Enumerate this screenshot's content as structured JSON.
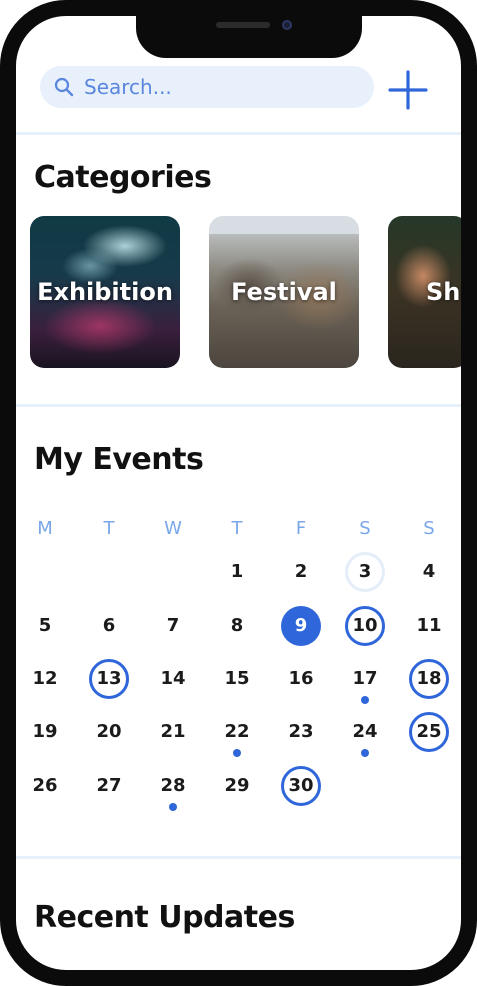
{
  "search": {
    "placeholder": "Search..."
  },
  "sections": {
    "categories_title": "Categories",
    "events_title": "My Events",
    "updates_title": "Recent Updates"
  },
  "categories": [
    {
      "label": "Exhibition"
    },
    {
      "label": "Festival"
    },
    {
      "label": "Sh"
    }
  ],
  "calendar": {
    "weekdays": [
      "M",
      "T",
      "W",
      "T",
      "F",
      "S",
      "S"
    ],
    "days": {
      "d1": "1",
      "d2": "2",
      "d3": "3",
      "d4": "4",
      "d5": "5",
      "d6": "6",
      "d7": "7",
      "d8": "8",
      "d9": "9",
      "d10": "10",
      "d11": "11",
      "d12": "12",
      "d13": "13",
      "d14": "14",
      "d15": "15",
      "d16": "16",
      "d17": "17",
      "d18": "18",
      "d19": "19",
      "d20": "20",
      "d21": "21",
      "d22": "22",
      "d23": "23",
      "d24": "24",
      "d25": "25",
      "d26": "26",
      "d27": "27",
      "d28": "28",
      "d29": "29",
      "d30": "30"
    },
    "selected_day": 9,
    "today_day": 3,
    "event_days_ringed": [
      10,
      13,
      18,
      25,
      30
    ],
    "days_with_dots": [
      17,
      22,
      24,
      28
    ]
  },
  "colors": {
    "accent": "#2f66da",
    "weekday_label": "#7aa6ea",
    "search_bg": "#e8f0fb"
  }
}
